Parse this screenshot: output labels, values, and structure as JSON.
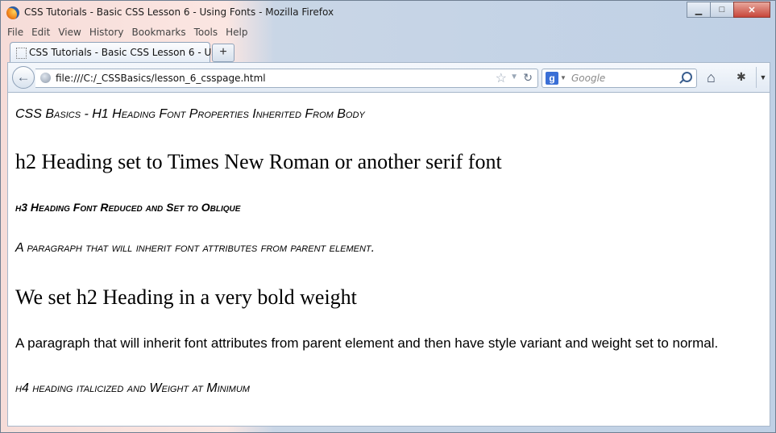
{
  "window": {
    "title": "CSS Tutorials - Basic CSS Lesson 6 - Using Fonts - Mozilla Firefox",
    "minimize": "▁",
    "maximize": "□",
    "close": "✕"
  },
  "menu": [
    "File",
    "Edit",
    "View",
    "History",
    "Bookmarks",
    "Tools",
    "Help"
  ],
  "tab": {
    "title": "CSS Tutorials - Basic CSS Lesson 6 - Usin...",
    "new_tab": "+"
  },
  "nav": {
    "url": "file:///C:/_CSSBasics/lesson_6_csspage.html",
    "search_engine": "g",
    "search_placeholder": "Google"
  },
  "page": {
    "h1": "CSS Basics - H1 Heading Font Properties Inherited From Body",
    "h2a": "h2 Heading set to Times New Roman or another serif font",
    "h3": "h3 Heading Font Reduced and Set to Oblique",
    "p1": "A paragraph that will inherit font attributes from parent element.",
    "h2b": "We set h2 Heading in a very bold weight",
    "p2": "A paragraph that will inherit font attributes from parent element and then have style variant and weight set to normal.",
    "h4": "h4 heading italicized and Weight at Minimum"
  },
  "icons": {
    "back": "back-arrow-icon",
    "star": "bookmark-star-icon",
    "reload": "reload-icon",
    "home": "home-icon"
  }
}
